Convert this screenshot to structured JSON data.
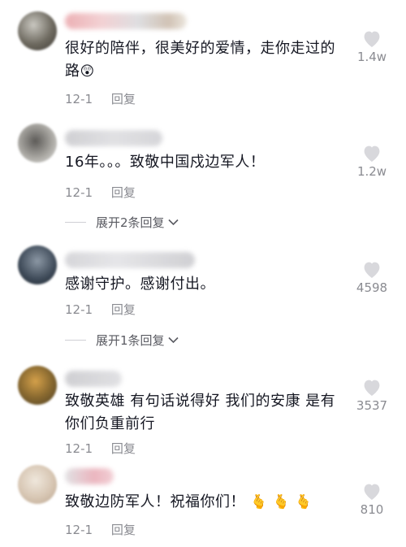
{
  "comments": [
    {
      "text": "很好的陪伴，很美好的爱情，走你走过的路",
      "emoji": "😲",
      "date": "12-1",
      "reply_label": "回复",
      "likes": "1.4w"
    },
    {
      "text": "16年。。。致敬中国戍边军人！",
      "date": "12-1",
      "reply_label": "回复",
      "likes": "1.2w",
      "expand_label": "展开2条回复"
    },
    {
      "text": "感谢守护。感谢付出。",
      "date": "12-1",
      "reply_label": "回复",
      "likes": "4598",
      "expand_label": "展开1条回复"
    },
    {
      "text": "致敬英雄 有句话说得好 我们的安康 是有你们负重前行",
      "date": "12-1",
      "reply_label": "回复",
      "likes": "3537"
    },
    {
      "text": "致敬边防军人！祝福你们！",
      "emoji": "🫰 🫰 🫰",
      "date": "12-1",
      "reply_label": "回复",
      "likes": "810"
    }
  ],
  "icons": {
    "like": "heart-icon",
    "expand": "chevron-down-icon"
  },
  "colors": {
    "text": "#161823",
    "meta": "#8a8b91",
    "heart": "#d8d8dc"
  }
}
